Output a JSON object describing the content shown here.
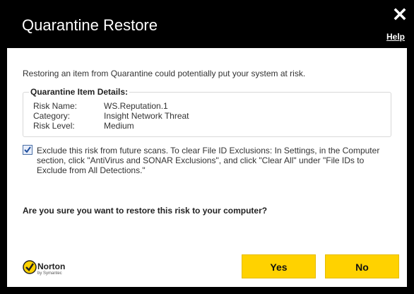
{
  "window": {
    "title": "Quarantine Restore",
    "help_label": "Help"
  },
  "intro": "Restoring an item from Quarantine could potentially put your system at risk.",
  "details": {
    "legend": "Quarantine Item Details:",
    "rows": [
      {
        "key": "Risk Name:",
        "value": "WS.Reputation.1"
      },
      {
        "key": "Category:",
        "value": "Insight Network Threat"
      },
      {
        "key": "Risk Level:",
        "value": "Medium"
      }
    ]
  },
  "exclusion": {
    "checked": true,
    "text": "Exclude this risk from future scans. To clear File ID Exclusions: In Settings, in the Computer section, click \"AntiVirus and SONAR Exclusions\", and click \"Clear All\" under \"File IDs to Exclude from All Detections.\""
  },
  "question": "Are you sure you want to restore this risk to your computer?",
  "brand": {
    "name": "Norton",
    "sub": "by Symantec",
    "icon": "norton-check-icon"
  },
  "buttons": {
    "yes": "Yes",
    "no": "No"
  },
  "colors": {
    "accent": "#ffd200",
    "window_bg": "#000000",
    "content_bg": "#ffffff"
  }
}
